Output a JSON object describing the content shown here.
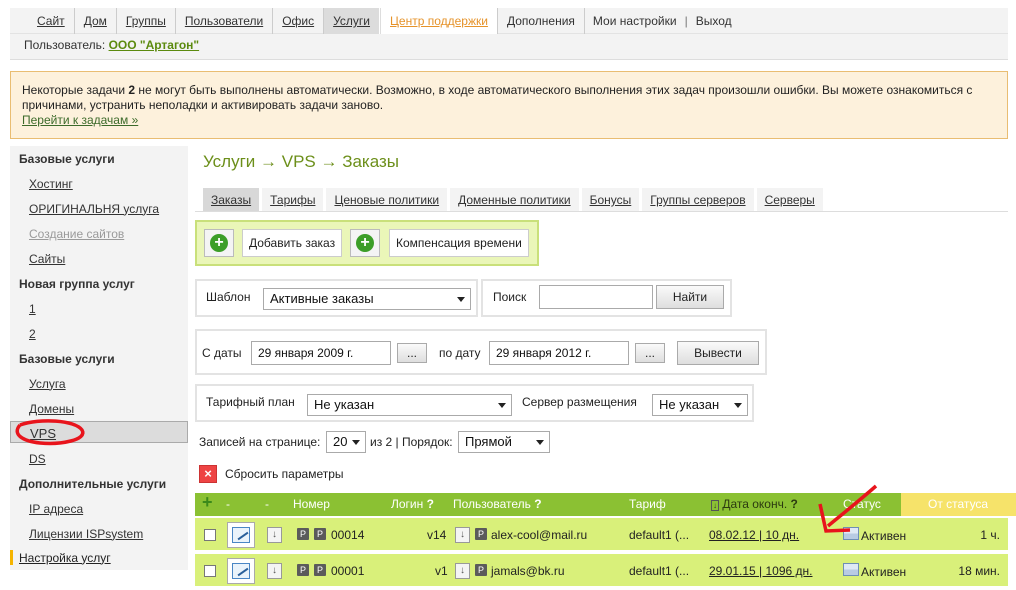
{
  "nav": {
    "links": [
      "Сайт",
      "Дом",
      "Группы",
      "Пользователи",
      "Офис",
      "Услуги",
      "Центр поддержки",
      "Дополнения",
      "Мои настройки",
      "|",
      "Выход"
    ]
  },
  "user": {
    "label": "Пользователь:",
    "org": "ООО \"Артагон\""
  },
  "warning": {
    "text_before": "Некоторые задачи ",
    "count": "2",
    "text_after": " не могут быть выполнены автоматически. Возможно, в ходе автоматического выполнения этих задач произошли ошибки. Вы можете ознакомиться с причинами, устранить неполадки и активировать задачи заново.",
    "link": "Перейти к задачам »"
  },
  "sidebar": {
    "items": [
      {
        "type": "header",
        "label": "Базовые услуги"
      },
      {
        "type": "item",
        "label": "Хостинг"
      },
      {
        "type": "item",
        "label": "ОРИГИНАЛЬНЯ услуга"
      },
      {
        "type": "item",
        "label": "Создание сайтов",
        "disabled": true
      },
      {
        "type": "item",
        "label": "Сайты"
      },
      {
        "type": "header",
        "label": "Новая группа услуг"
      },
      {
        "type": "item",
        "label": "1"
      },
      {
        "type": "item",
        "label": "2"
      },
      {
        "type": "header",
        "label": "Базовые услуги"
      },
      {
        "type": "item",
        "label": "Услуга"
      },
      {
        "type": "item",
        "label": "Домены"
      },
      {
        "type": "item",
        "label": "VPS",
        "selected": true
      },
      {
        "type": "item",
        "label": "DS"
      },
      {
        "type": "header",
        "label": "Дополнительные услуги"
      },
      {
        "type": "item",
        "label": "IP адреса"
      },
      {
        "type": "item",
        "label": "Лицензии ISPsystem"
      },
      {
        "type": "link",
        "label": "Настройка услуг"
      }
    ]
  },
  "page": {
    "title": "Услуги → VPS → Заказы"
  },
  "tabs": [
    "Заказы",
    "Тарифы",
    "Ценовые политики",
    "Доменные политики",
    "Бонусы",
    "Группы серверов",
    "Серверы"
  ],
  "toolbar": {
    "add_order": "Добавить заказ",
    "time_comp": "Компенсация времени"
  },
  "filters": {
    "template_label": "Шаблон",
    "template_value": "Активные заказы",
    "search_label": "Поиск",
    "search_value": "",
    "find_button": "Найти",
    "from_label": "С даты",
    "from_value": "29 января 2009 г.",
    "to_label": "по дату",
    "to_value": "29 января 2012 г.",
    "dots": "...",
    "show_button": "Вывести",
    "tariff_label": "Тарифный план",
    "tariff_value": "Не указан",
    "server_label": "Сервер размещения",
    "server_value": "Не указан",
    "per_page_label": "Записей на странице:",
    "per_page_value": "20",
    "pages_text": "из 2 | Порядок:",
    "order_value": "Прямой",
    "reset": "Сбросить параметры"
  },
  "table": {
    "headers": {
      "plus": "+",
      "dash1": "-",
      "dash2": "-",
      "number": "Номер",
      "login": "Логин",
      "user": "Пользователь",
      "tariff": "Тариф",
      "end_date": "Дата оконч.",
      "status": "Статус",
      "since_status": "От статуса",
      "q": "?"
    },
    "rows": [
      {
        "number": "00014",
        "login": "v14",
        "user": "alex-cool@mail.ru",
        "tariff": "default1 (...",
        "end_date": "08.02.12 | 10 дн.",
        "status": "Активен",
        "since": "1 ч."
      },
      {
        "number": "00001",
        "login": "v1",
        "user": "jamals@bk.ru",
        "tariff": "default1 (...",
        "end_date": "29.01.15 | 1096 дн.",
        "status": "Активен",
        "since": "18 мин."
      }
    ]
  },
  "colors": {
    "accent_green": "#8bc133",
    "row_green": "#d9f07a",
    "title_green": "#6c8f1a",
    "support_orange": "#e6932a",
    "warning_bg": "#fdf1dc",
    "annotation_red": "#e8141c"
  }
}
